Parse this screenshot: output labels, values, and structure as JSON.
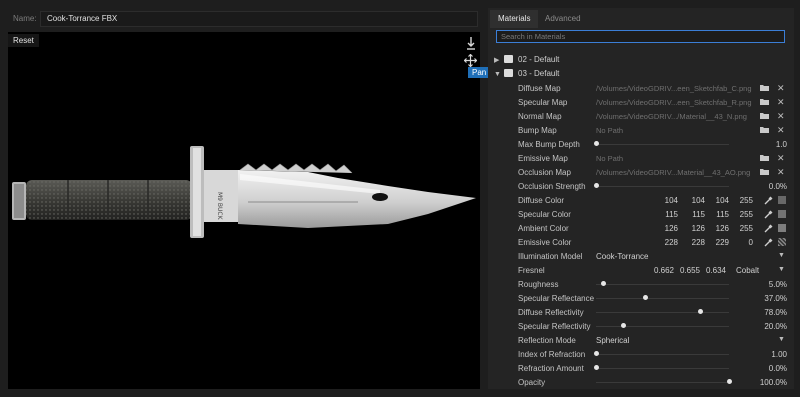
{
  "header": {
    "name_label": "Name:",
    "name_value": "Cook-Torrance FBX"
  },
  "viewport": {
    "reset_label": "Reset",
    "pan_tooltip": "Pan",
    "icons": [
      "download-icon",
      "move-icon"
    ]
  },
  "panel": {
    "tabs": [
      {
        "label": "Materials",
        "active": true
      },
      {
        "label": "Advanced",
        "active": false
      }
    ],
    "search_placeholder": "Search in Materials",
    "materials": [
      {
        "name": "02 - Default",
        "expanded": false
      },
      {
        "name": "03 - Default",
        "expanded": true
      }
    ],
    "maps": [
      {
        "label": "Diffuse Map",
        "path": "/Volumes/VideoGDRIV...een_Sketchfab_C.png"
      },
      {
        "label": "Specular Map",
        "path": "/Volumes/VideoGDRIV...een_Sketchfab_R.png"
      },
      {
        "label": "Normal Map",
        "path": "/Volumes/VideoGDRIV.../Material__43_N.png"
      },
      {
        "label": "Bump Map",
        "path": "No Path"
      }
    ],
    "max_bump": {
      "label": "Max Bump Depth",
      "value": "1.0",
      "fraction": 0.0
    },
    "maps2": [
      {
        "label": "Emissive Map",
        "path": "No Path"
      },
      {
        "label": "Occlusion Map",
        "path": "/Volumes/VideoGDRIV...Material__43_AO.png"
      }
    ],
    "occlusion_strength": {
      "label": "Occlusion Strength",
      "value": "0.0%",
      "fraction": 0.0
    },
    "colors": [
      {
        "label": "Diffuse Color",
        "r": "104",
        "g": "104",
        "b": "104",
        "a": "255",
        "hex": "#686868",
        "transparent": false
      },
      {
        "label": "Specular Color",
        "r": "115",
        "g": "115",
        "b": "115",
        "a": "255",
        "hex": "#737373",
        "transparent": false
      },
      {
        "label": "Ambient Color",
        "r": "126",
        "g": "126",
        "b": "126",
        "a": "255",
        "hex": "#7e7e7e",
        "transparent": false
      },
      {
        "label": "Emissive Color",
        "r": "228",
        "g": "228",
        "b": "229",
        "a": "0",
        "hex": "#e4e4e5",
        "transparent": true
      }
    ],
    "illumination": {
      "label": "Illumination Model",
      "value": "Cook-Torrance"
    },
    "fresnel": {
      "label": "Fresnel",
      "values": [
        "0.662",
        "0.655",
        "0.634"
      ],
      "preset": "Cobalt"
    },
    "sliders": [
      {
        "label": "Roughness",
        "value": "5.0%",
        "fraction": 0.05
      },
      {
        "label": "Specular Reflectance",
        "value": "37.0%",
        "fraction": 0.37
      },
      {
        "label": "Diffuse Reflectivity",
        "value": "78.0%",
        "fraction": 0.78
      },
      {
        "label": "Specular Reflectivity",
        "value": "20.0%",
        "fraction": 0.2
      }
    ],
    "reflection_mode": {
      "label": "Reflection Mode",
      "value": "Spherical"
    },
    "sliders2": [
      {
        "label": "Index of Refraction",
        "value": "1.00",
        "fraction": 0.0
      },
      {
        "label": "Refraction Amount",
        "value": "0.0%",
        "fraction": 0.0
      },
      {
        "label": "Opacity",
        "value": "100.0%",
        "fraction": 1.0
      }
    ]
  }
}
